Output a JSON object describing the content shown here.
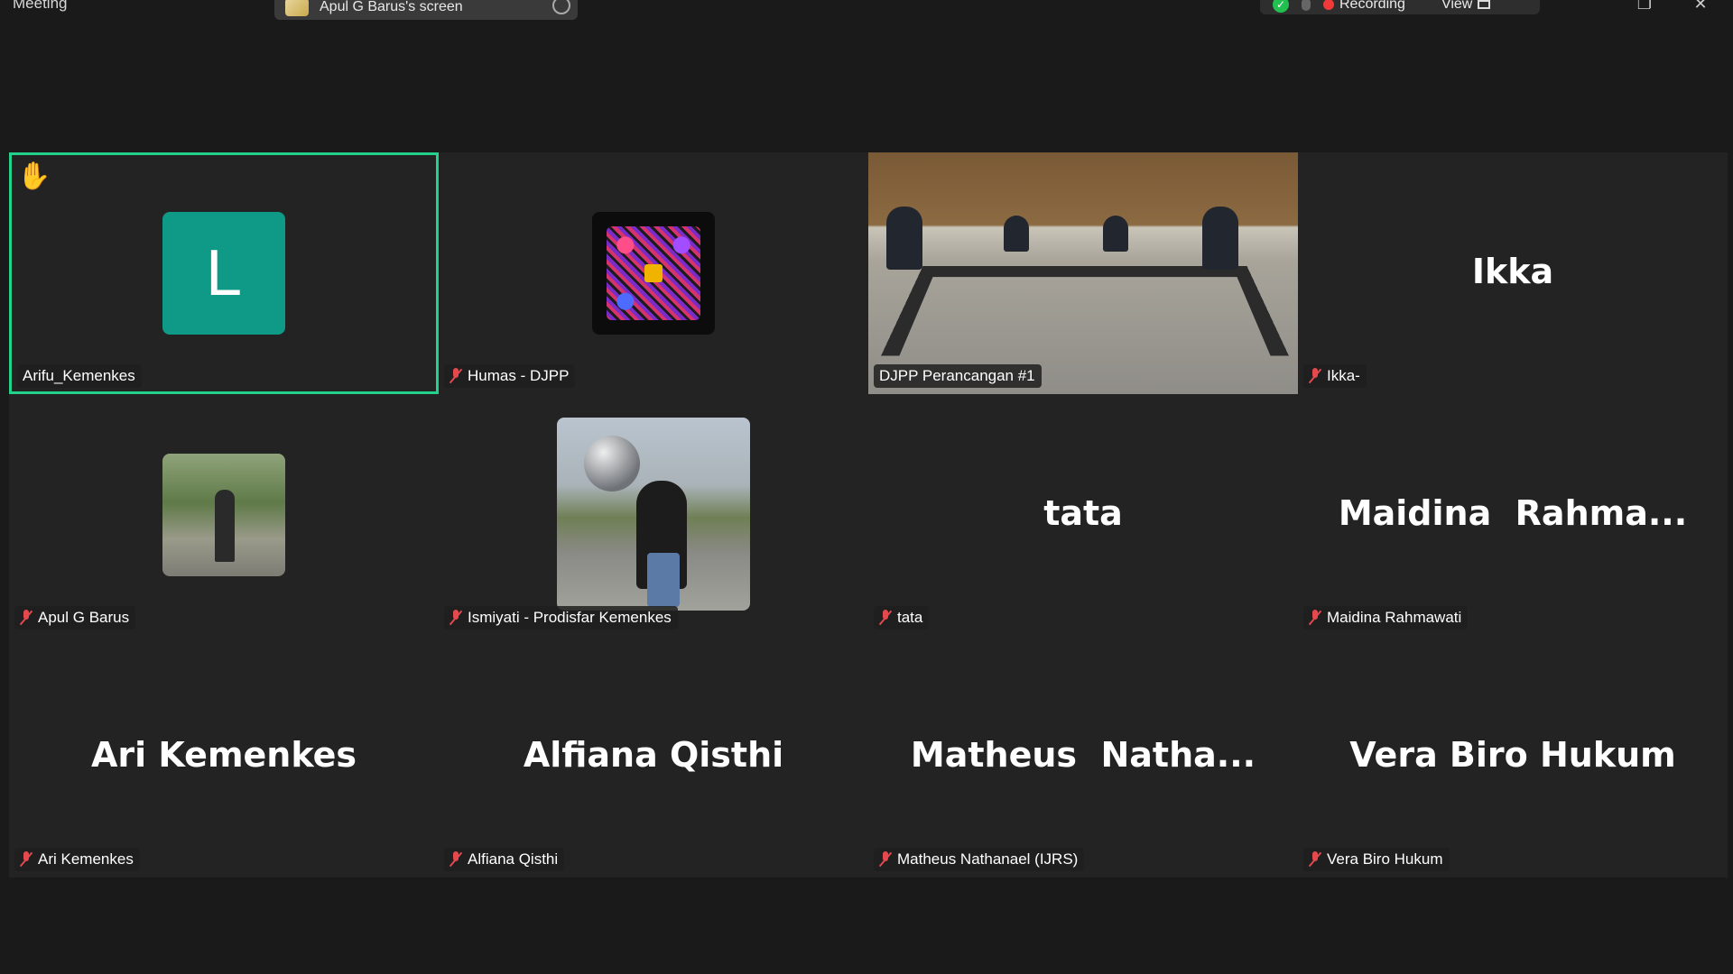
{
  "topbar": {
    "app_title": "Meeting",
    "share_label": "Apul G Barus's screen",
    "recording_label": "Recording",
    "view_label": "View",
    "minimize": "–",
    "restore": "❐",
    "close": "✕"
  },
  "colors": {
    "active_border": "#23d18b",
    "muted_mic": "#e5484d",
    "avatar_teal": "#0e9a86",
    "tile_bg": "#232323",
    "recording_dot": "#f03a3a"
  },
  "tiles": [
    {
      "name": "Arifu_Kemenkes",
      "avatar": "L",
      "muted": false,
      "active": true,
      "hand_raised": true
    },
    {
      "name": "Humas - DJPP",
      "muted": true,
      "avatar_type": "qr-code"
    },
    {
      "name": "DJPP Perancangan #1",
      "muted": false,
      "video": "meeting-room"
    },
    {
      "name": "Ikka-",
      "muted": true,
      "display_name": "Ikka"
    },
    {
      "name": "Apul G Barus",
      "muted": true,
      "avatar_type": "photo"
    },
    {
      "name": "Ismiyati - Prodisfar Kemenkes",
      "muted": true,
      "avatar_type": "photo"
    },
    {
      "name": "tata",
      "muted": true,
      "display_name": "tata"
    },
    {
      "name": "Maidina Rahmawati",
      "muted": true,
      "display_name": "Maidina  Rahma..."
    },
    {
      "name": "Ari Kemenkes",
      "muted": true,
      "display_name": "Ari Kemenkes"
    },
    {
      "name": "Alfiana Qisthi",
      "muted": true,
      "display_name": "Alfiana Qisthi"
    },
    {
      "name": "Matheus Nathanael (IJRS)",
      "muted": true,
      "display_name": "Matheus  Natha..."
    },
    {
      "name": "Vera Biro Hukum",
      "muted": true,
      "display_name": "Vera Biro Hukum"
    }
  ]
}
